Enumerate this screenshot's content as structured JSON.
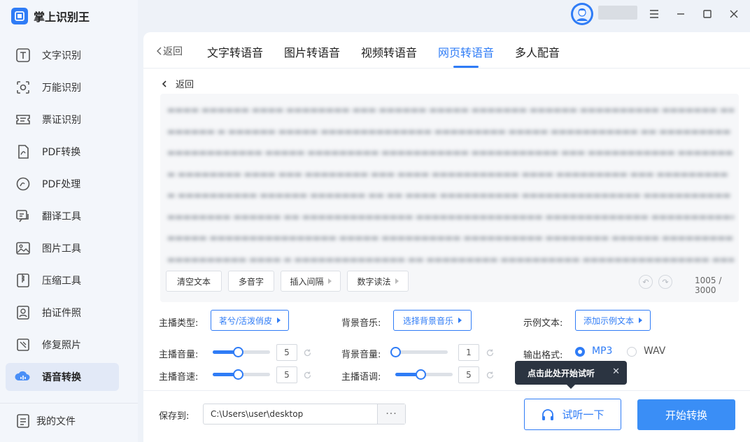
{
  "app": {
    "name": "掌上识别王"
  },
  "sidebar": {
    "items": [
      {
        "label": "文字识别",
        "icon": "text-recognition-icon"
      },
      {
        "label": "万能识别",
        "icon": "universal-scan-icon"
      },
      {
        "label": "票证识别",
        "icon": "ticket-icon"
      },
      {
        "label": "PDF转换",
        "icon": "pdf-convert-icon"
      },
      {
        "label": "PDF处理",
        "icon": "pdf-process-icon"
      },
      {
        "label": "翻译工具",
        "icon": "translate-icon"
      },
      {
        "label": "图片工具",
        "icon": "image-tools-icon"
      },
      {
        "label": "压缩工具",
        "icon": "compress-icon"
      },
      {
        "label": "拍证件照",
        "icon": "id-photo-icon"
      },
      {
        "label": "修复照片",
        "icon": "repair-photo-icon"
      },
      {
        "label": "语音转换",
        "icon": "voice-convert-icon",
        "active": true
      }
    ],
    "my_files": "我的文件"
  },
  "titlebar": {
    "menu_icon": "menu-icon",
    "minimize_icon": "minimize-icon",
    "maximize_icon": "maximize-icon",
    "close_icon": "close-icon"
  },
  "tabs": {
    "back": "返回",
    "items": [
      "文字转语音",
      "图片转语音",
      "视频转语音",
      "网页转语音",
      "多人配音"
    ],
    "active_index": 3
  },
  "content": {
    "back": "返回",
    "text_buttons": [
      "清空文本",
      "多音字",
      "插入间隔",
      "数字读法"
    ],
    "counter": "1005 / 3000"
  },
  "settings": {
    "anchor_type_label": "主播类型:",
    "anchor_type_value": "茗兮/活泼俏皮",
    "bgm_label": "背景音乐:",
    "bgm_value": "选择背景音乐",
    "sample_label": "示例文本:",
    "sample_value": "添加示例文本",
    "anchor_volume_label": "主播音量:",
    "anchor_volume": "5",
    "bgm_volume_label": "背景音量:",
    "bgm_volume": "1",
    "output_format_label": "输出格式:",
    "format_options": [
      "MP3",
      "WAV"
    ],
    "format_selected": "MP3",
    "anchor_speed_label": "主播音速:",
    "anchor_speed": "5",
    "anchor_pitch_label": "主播语调:",
    "anchor_pitch": "5",
    "slider_levels": {
      "anchor_volume": 0.44,
      "bgm_volume": 0.0,
      "anchor_speed": 0.44,
      "anchor_pitch": 0.44
    }
  },
  "tooltip": {
    "text": "点击此处开始试听",
    "close": "✕"
  },
  "bottom": {
    "save_label": "保存到:",
    "save_path": "C:\\Users\\user\\desktop",
    "more": "···",
    "listen_button": "试听一下",
    "start_button": "开始转换"
  },
  "colors": {
    "accent": "#2f7cf6",
    "tooltip_bg": "#2b3441"
  }
}
